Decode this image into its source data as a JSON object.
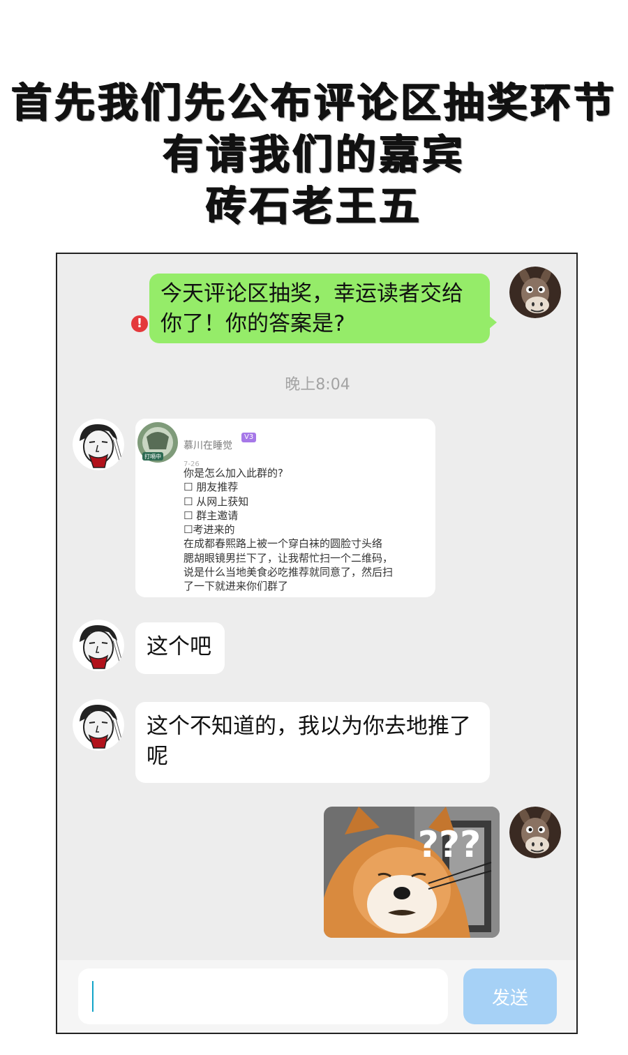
{
  "header": {
    "lines": [
      "首先我们先公布评论区抽奖环节",
      "有请我们的嘉宾",
      "砖石老王五"
    ]
  },
  "chat": {
    "messages": [
      {
        "side": "right",
        "text": "今天评论区抽奖，幸运读者交给你了！你的答案是?",
        "line1": "今天评论区抽奖，幸运读者交给",
        "line2": "你了！你的答案是?",
        "status": "send-failed"
      },
      {
        "side": "left",
        "type": "screenshot-card"
      },
      {
        "side": "left",
        "text": "这个吧"
      },
      {
        "side": "left",
        "text": "这个不知道的，我以为你去地推了呢",
        "line1": "这个不知道的，我以为你去地推了",
        "line2": "呢"
      },
      {
        "side": "right",
        "type": "sticker",
        "text": "???"
      }
    ],
    "timestamp": "晚上8:04",
    "error_glyph": "!",
    "card": {
      "username": "慕川在睡觉",
      "level_badge": "V3",
      "date": "7-26",
      "avatar_tag": "打嗝中",
      "lines": [
        "你是怎么加入此群的?",
        "☐  朋友推荐",
        "☐  从网上获知",
        "☐  群主邀请",
        "☐考进来的",
        "      在成都春熙路上被一个穿白袜的圆脸寸头络",
        "腮胡眼镜男拦下了，让我帮忙扫一个二维码，",
        "说是什么当地美食必吃推荐就同意了，然后扫",
        "了一下就进来你们群了"
      ]
    },
    "sticker_text": "???"
  },
  "input_bar": {
    "placeholder": "",
    "value": "",
    "send_label": "发送"
  },
  "colors": {
    "chat_background": "#ededed",
    "self_bubble": "#95ec69",
    "other_bubble": "#ffffff",
    "send_button": "#a6d1f6",
    "error_icon": "#e4393c",
    "timestamp": "#a3a3a3",
    "caret": "#12a4c8"
  },
  "icons": {
    "self_avatar": "donkey-avatar-icon",
    "other_avatar": "sketch-face-avatar-icon",
    "error": "exclamation-circle-icon"
  }
}
